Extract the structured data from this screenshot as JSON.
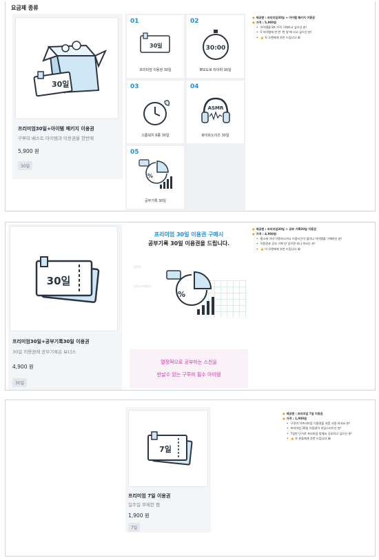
{
  "section_heading": "요금제 종류",
  "colors": {
    "accent": "#1c8fd8",
    "pink": "#c63aa3",
    "dot": "#e8a21c",
    "ink": "#2a3441",
    "tile_bg": "#cfe6f5"
  },
  "panel1": {
    "card": {
      "icon_name": "box-ticket-icon",
      "ticket_text": "30일",
      "title": "프리미엄30일+아이템 패키지 이용권",
      "subtitle": "구루미 베스트 아이템과 이용권을 한번에",
      "price": "5,900 원",
      "tag": "30일"
    },
    "tiles": [
      {
        "num": "01",
        "label": "프리미엄 이용권 30일",
        "icon": "ticket-icon",
        "icon_text": "30일"
      },
      {
        "num": "02",
        "label": "뽀모도로 타이머 30일",
        "icon": "stopwatch-icon",
        "icon_text": "30:00"
      },
      {
        "num": "03",
        "label": "스톱워치 6종 30일",
        "icon": "clock-leaf-icon",
        "icon_text": ""
      },
      {
        "num": "04",
        "label": "화이트노이즈 30일",
        "icon": "headphones-icon",
        "icon_text": "ASMR"
      },
      {
        "num": "05",
        "label": "공부기록 30일",
        "icon": "chart-icon",
        "icon_text": "%"
      }
    ],
    "info": {
      "title": "제공맨 : 프리미엄30일 + 아이템 패키지 이용권",
      "price": "가격 : 5,900원",
      "bullets": [
        "아이템을 8X 가격 구매하고 싶으신 분!",
        "5 아이템에 한 번 '한 달'에 사고 싶으신 분!",
        "👍 꼭 오렌에게 추천 드립니다 😀"
      ]
    }
  },
  "panel2": {
    "card": {
      "icon_name": "ticket-icon",
      "ticket_text": "30일",
      "title": "프리미엄30일+공부기록30일 이용권",
      "subtitle": "30일 이용권에 공부기록은 보너스",
      "price": "4,900 원",
      "tag": "30일"
    },
    "promo": {
      "line1": "프리미엄 30일 이용권 구매시",
      "line2": "공부기록 30일 이용권을 드립니다.",
      "box_line1": "열정적으로 공부하는 스친을",
      "box_line2": "만날수 있는 구루미 필수 아이템",
      "faint_labels": [
        "[제목]",
        "[공부시작예상]"
      ]
    },
    "info": {
      "title": "제공맨 : 프리미엄30일 + 공부 기록30일 이용권",
      "price": "가격 : 4,900원",
      "bullets": [
        "평소에 이미 이용하시거나 이용시간이 많거나 아이템을 구매하신 분!",
        "이용권과 공부 기록 만 있으면 되니 하시는 분!",
        "👍 이 오렌에게 추천 드립니다 😀"
      ]
    }
  },
  "panel3": {
    "card": {
      "icon_name": "ticket-icon",
      "ticket_text": "7일",
      "title": "프리미엄 7일 이용권",
      "subtitle": "일주일 무제한 캠",
      "price": "1,900 원",
      "tag": "7일"
    },
    "info": {
      "title": "제공맨 : 프리미엄 7일 이용권",
      "price": "가격 : 1,900원",
      "bullets": [
        "구루미 이프리미엄 이용권을 처음 사용 하셔요 분!",
        "프리미엄 30일 이용권이 부담스러우신 분!",
        "7일만 단기로 프리미엄 방에서 공부하고 싶으신 분!",
        "👍 꼭 분들에게 추천 드립니다 😀"
      ]
    }
  }
}
